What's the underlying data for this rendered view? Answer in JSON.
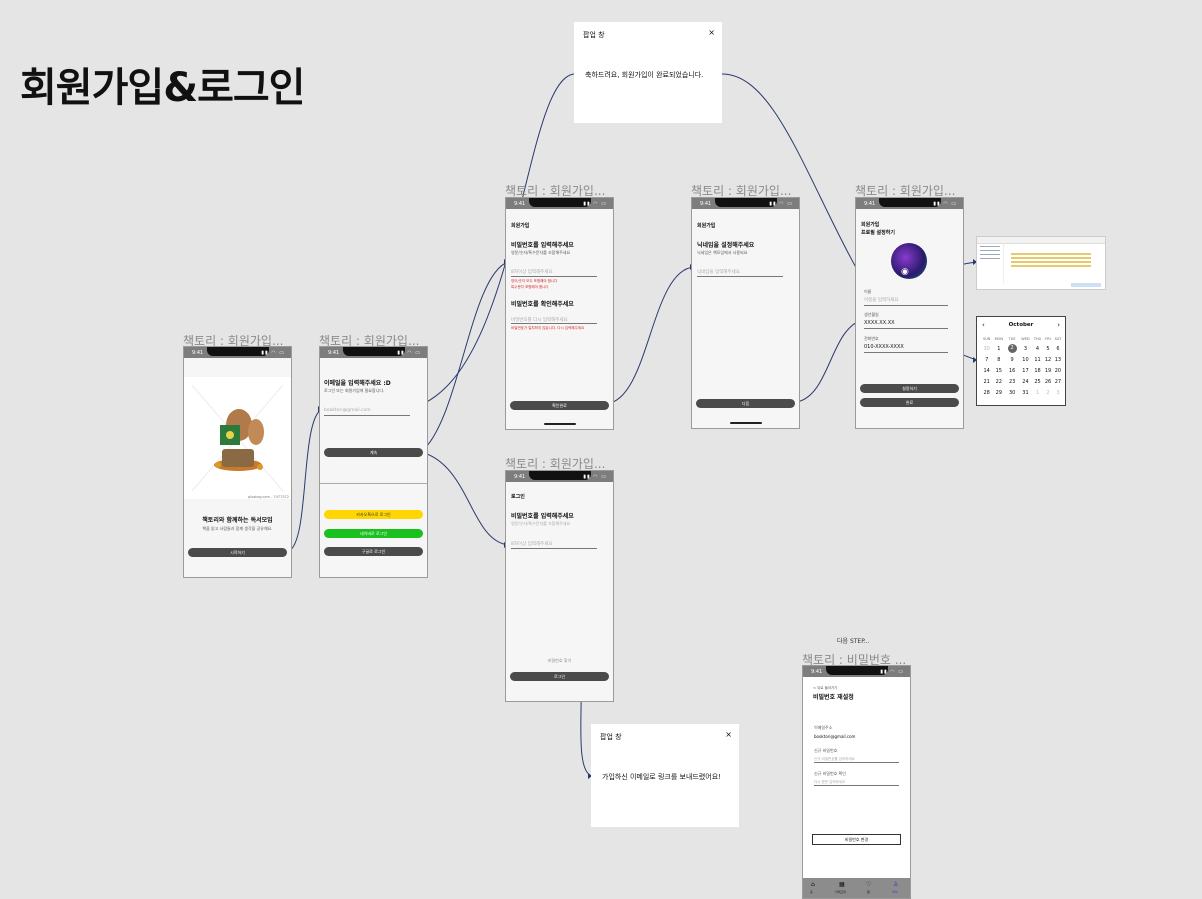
{
  "page_title": "회원가입&로그인",
  "frames": {
    "f1_label": "책토리 : 회원가입...",
    "f2_label": "책토리 : 회원가입...",
    "f3_label": "책토리 : 회원가입...",
    "f4_label": "책토리 : 회원가입...",
    "f5_label": "책토리 : 회원가입...",
    "f6_label": "책토리 : 회원가입...",
    "f7_label": "책토리 : 비밀번호 ..."
  },
  "status": {
    "time": "9:41"
  },
  "splash": {
    "credit": "pixabay.com - 7477372",
    "headline": "책토리와 함께하는 독서모임",
    "sub": "책을 읽고 사람들과 함께 생각을 공유해요.",
    "start_button": "시작하기"
  },
  "email_step": {
    "heading": "이메일을 입력해주세요 :D",
    "sub": "로그인 또는 회원가입에 필요합니다.",
    "email_value": "booktori@gmail.com",
    "next_button": "계속",
    "kakao_button": "카카오톡으로 로그인",
    "naver_button": "네이버로 로그인",
    "google_button": "구글로 로그인"
  },
  "signup_password": {
    "title": "회원가입",
    "heading": "비밀번호를 입력해주세요",
    "sub": "영문/숫자/특수문자를 조합해주세요",
    "pw_placeholder": "8자이상 입력해주세요",
    "err1": "영어/숫자 모두 포함해야 합니다",
    "err2": "특수문자 포함해야 합니다",
    "confirm_heading": "비밀번호를 확인해주세요",
    "confirm_placeholder": "비밀번호를 다시 입력해주세요",
    "confirm_err": "비밀번호가 일치하지 않습니다. 다시 입력해주세요",
    "button": "확인완료"
  },
  "nickname_step": {
    "title": "회원가입",
    "heading": "닉네임을 설정해주세요",
    "sub": "닉네임은 책모임에서 사용되요",
    "placeholder": "닉네임을 입력해주세요",
    "button": "다음"
  },
  "profile_step": {
    "title1": "회원가입",
    "title2": "프로필 설정하기",
    "name_label": "이름",
    "name_placeholder": "이름을 입력하세요",
    "birth_label": "생년월일",
    "birth_value": "XXXX.XX.XX",
    "phone_label": "전화번호",
    "phone_value": "010-XXXX-XXXX",
    "save_button": "설정하기",
    "done_button": "완료"
  },
  "login_screen": {
    "title": "로그인",
    "heading": "비밀번호를 입력해주세요",
    "sub": "영문/숫자/특수문자를 조합해주세요",
    "placeholder": "8자이상 입력해주세요",
    "forgot": "비밀번호 찾기",
    "button": "로그인"
  },
  "popup_signup": {
    "title": "팝업 창",
    "close": "×",
    "message": "축하드려요, 회원가입이 완료되었습니다."
  },
  "popup_email": {
    "title": "팝업 창",
    "close": "×",
    "message": "가입하신 이메일로 링크를 보내드렸어요!"
  },
  "calendar": {
    "month": "October",
    "days": [
      "SUN",
      "MON",
      "TUE",
      "WED",
      "THU",
      "FRI",
      "SAT"
    ],
    "weeks": [
      [
        "30",
        "1",
        "2",
        "3",
        "4",
        "5",
        "6"
      ],
      [
        "7",
        "8",
        "9",
        "10",
        "11",
        "12",
        "13"
      ],
      [
        "14",
        "15",
        "16",
        "17",
        "18",
        "19",
        "20"
      ],
      [
        "21",
        "22",
        "23",
        "24",
        "25",
        "26",
        "27"
      ],
      [
        "28",
        "29",
        "30",
        "31",
        "1",
        "2",
        "3"
      ]
    ],
    "selected": "2"
  },
  "next_step_label": "다음 STEP...",
  "reset_pw": {
    "back": "< 뒤로 돌아가기",
    "title": "비밀번호 재설정",
    "email_label": "이메일주소",
    "email_value": "booktori@gmail.com",
    "new_label": "신규 비밀번호",
    "new_placeholder": "신규 비밀번호를 입력하세요",
    "confirm_label": "신규 비밀번호 확인",
    "confirm_placeholder": "다시 한번 입력하세요",
    "button": "비밀번호 변경",
    "tabs": [
      "홈",
      "카테고리",
      "찜",
      "마이"
    ]
  },
  "colors": {
    "kakao": "#ffd600",
    "naver": "#19c11e",
    "button": "#4b4b4b",
    "connector": "#2b3a6b"
  }
}
